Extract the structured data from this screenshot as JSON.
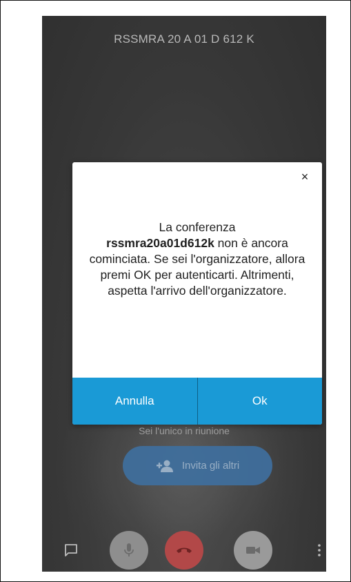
{
  "call": {
    "title": "RSSMRA 20 A 01 D 612 K",
    "alone_text": "Sei l'unico in riunione",
    "invite_label": "Invita gli altri"
  },
  "dialog": {
    "message_prefix": "La conferenza",
    "room_name": "rssmra20a01d612k",
    "message_suffix": " non è ancora cominciata. Se sei l'organizzatore, allora premi OK per autenticarti. Altrimenti, aspetta l'arrivo dell'organizzatore.",
    "cancel_label": "Annulla",
    "ok_label": "Ok",
    "close_symbol": "×"
  },
  "icons": {
    "close": "close-icon",
    "invite": "add-person-icon",
    "chat": "chat-icon",
    "mic": "microphone-icon",
    "hangup": "hangup-icon",
    "camera": "camera-icon",
    "more": "more-vertical-icon"
  },
  "colors": {
    "dialog_buttons": "#1a9ad6",
    "hangup": "#b24848",
    "invite": "#3f6f9e"
  }
}
